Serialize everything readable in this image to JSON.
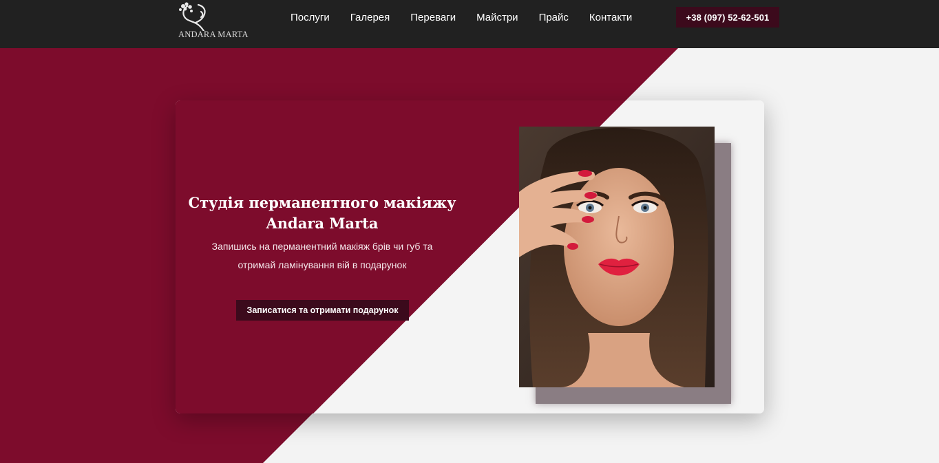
{
  "header": {
    "logo_text": "ANDARA MARTA",
    "nav": [
      "Послуги",
      "Галерея",
      "Переваги",
      "Майстри",
      "Прайс",
      "Контакти"
    ],
    "phone": "+38 (097) 52-62-501"
  },
  "hero": {
    "title_line1": "Студія перманентного макіяжу",
    "title_line2": "Andara Marta",
    "subtitle_line1": "Запишись на перманентний макіяж брів чи губ та",
    "subtitle_line2": "отримай ламінування вій в подарунок",
    "cta_label": "Записатися та отримати подарунок",
    "photo_icon": "portrait-woman-image"
  },
  "colors": {
    "header_bg": "#212121",
    "burgundy": "#7d0c2c",
    "dark_burgundy": "#3c0a1c",
    "light_bg": "#f3f3f3"
  }
}
